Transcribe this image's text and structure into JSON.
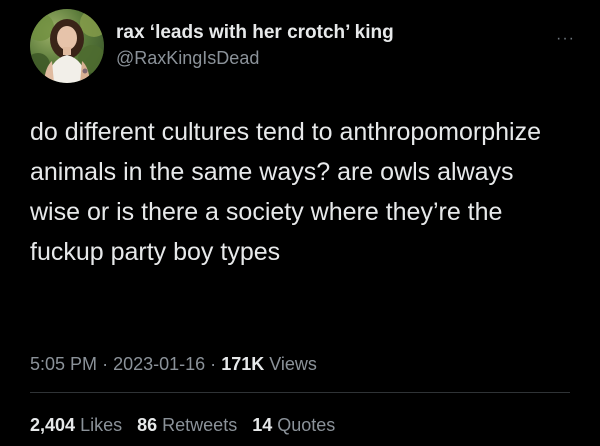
{
  "author": {
    "display_name": "rax ‘leads with her crotch’ king",
    "handle": "@RaxKingIsDead",
    "avatar_icon": "profile-photo"
  },
  "more_icon": "···",
  "tweet": {
    "text": "do different cultures tend to anthropomorphize animals in the same ways? are owls always wise or is there a society where they’re the fuckup party boy types"
  },
  "meta": {
    "time": "5:05 PM",
    "separator": "·",
    "date": "2023-01-16",
    "views_count": "171K",
    "views_label": "Views"
  },
  "stats": {
    "likes_count": "2,404",
    "likes_label": "Likes",
    "retweets_count": "86",
    "retweets_label": "Retweets",
    "quotes_count": "14",
    "quotes_label": "Quotes"
  },
  "colors": {
    "background": "#000000",
    "primary_text": "#e7e9ea",
    "secondary_text": "#8b9299",
    "divider": "#2f3336"
  }
}
